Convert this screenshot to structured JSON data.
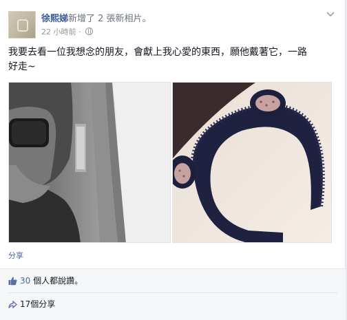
{
  "post": {
    "author": "徐熙娣",
    "action": "新增了 2 張新相片。",
    "time": "22 小時前",
    "audience_icon": "globe-icon",
    "menu_icon": "chevron-down-icon",
    "text_line1": "我要去看一位我想念的朋友，會獻上我心愛的東西，願他戴著它，一路",
    "text_line2": "好走~",
    "photos": [
      {
        "alt": "selfie-train-window"
      },
      {
        "alt": "black-bear-ear-headband"
      }
    ],
    "share_link": "分享"
  },
  "footer": {
    "likes_count": "30",
    "likes_text": " 個人都說讚。",
    "shares_text": "17個分享"
  },
  "colors": {
    "link": "#3b5998",
    "meta": "#90949c",
    "footer_bg": "#f6f7f9"
  }
}
